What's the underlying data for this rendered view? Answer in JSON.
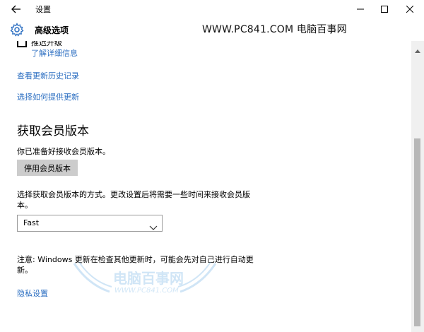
{
  "window": {
    "title": "设置",
    "minimize_icon": "minimize-icon",
    "maximize_icon": "maximize-icon",
    "close_icon": "close-icon"
  },
  "header": {
    "title": "高级选项",
    "icon": "gear-icon",
    "watermark": "WWW.PC841.COM 电脑百事网"
  },
  "content": {
    "partial_option": "推迟升级",
    "learn_more": "了解详细信息",
    "link_history": "查看更新历史记录",
    "link_choose": "选择如何提供更新",
    "insider_heading": "获取会员版本",
    "insider_status": "你已准备好接收会员版本。",
    "stop_button": "停用会员版本",
    "pace_desc": "选择获取会员版本的方式。更改设置后将需要一些时间来接收会员版本。",
    "pace_value": "Fast",
    "note": "注意: Windows 更新在检查其他更新时，可能会先对自己进行自动更新。",
    "privacy_link": "隐私设置"
  },
  "watermark_logo": {
    "name": "电脑百事网",
    "url": "WWW.PC841.COM"
  },
  "colors": {
    "link": "#2b6ec1",
    "button_bg": "#cccccc",
    "scroll_thumb": "#b7b7b7"
  }
}
